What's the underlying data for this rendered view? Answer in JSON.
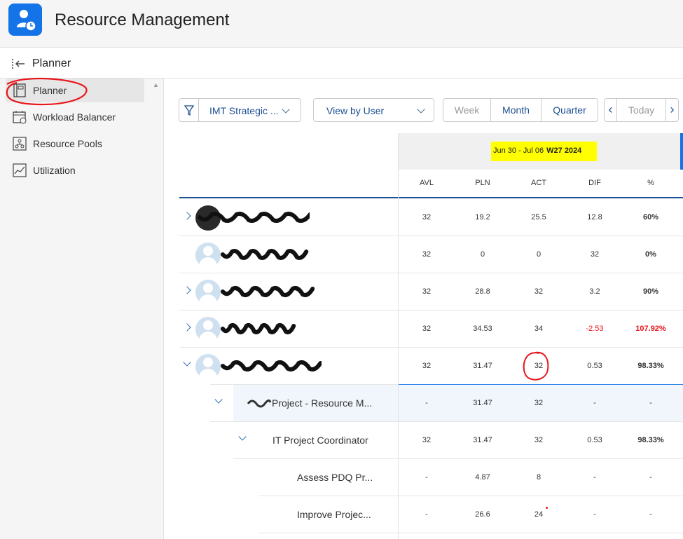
{
  "app": {
    "title": "Resource Management",
    "logo_icon": "user-clock-icon",
    "brand_color": "#1473e6"
  },
  "page": {
    "title": "Planner",
    "collapse_icon": "collapse-left-icon"
  },
  "sidebar": {
    "items": [
      {
        "label": "Planner",
        "icon": "planner-icon",
        "active": true
      },
      {
        "label": "Workload Balancer",
        "icon": "calendar-check-icon",
        "active": false
      },
      {
        "label": "Resource Pools",
        "icon": "org-chart-icon",
        "active": false
      },
      {
        "label": "Utilization",
        "icon": "line-chart-icon",
        "active": false
      }
    ]
  },
  "toolbar": {
    "filter_icon": "filter-icon",
    "project_filter": "IMT Strategic ...",
    "view_select": "View by User",
    "period_tabs": [
      {
        "label": "Week",
        "state": "disabled"
      },
      {
        "label": "Month",
        "state": "enabled"
      },
      {
        "label": "Quarter",
        "state": "enabled"
      }
    ],
    "prev_label": "‹",
    "today_label": "Today",
    "next_label": "›"
  },
  "grid": {
    "week_range": "Jun 30 - Jul 06",
    "week_code": "W27 2024",
    "columns": [
      "AVL",
      "PLN",
      "ACT",
      "DIF",
      "%"
    ],
    "rows": [
      {
        "label": "",
        "level": 0,
        "expander": "collapsed",
        "avatar": "photo",
        "redacted": true,
        "AVL": "32",
        "PLN": "19.2",
        "ACT": "25.5",
        "DIF": "12.8",
        "PCT": "60%",
        "over": false
      },
      {
        "label": "",
        "level": 0,
        "expander": "none",
        "avatar": "placeholder",
        "redacted": true,
        "AVL": "32",
        "PLN": "0",
        "ACT": "0",
        "DIF": "32",
        "PCT": "0%",
        "over": false
      },
      {
        "label": "",
        "level": 0,
        "expander": "collapsed",
        "avatar": "placeholder",
        "redacted": true,
        "AVL": "32",
        "PLN": "28.8",
        "ACT": "32",
        "DIF": "3.2",
        "PCT": "90%",
        "over": false
      },
      {
        "label": "",
        "level": 0,
        "expander": "collapsed",
        "avatar": "placeholder",
        "redacted": true,
        "AVL": "32",
        "PLN": "34.53",
        "ACT": "34",
        "DIF": "-2.53",
        "PCT": "107.92%",
        "over": true
      },
      {
        "label": "",
        "level": 0,
        "expander": "expanded",
        "avatar": "placeholder",
        "redacted": true,
        "AVL": "32",
        "PLN": "31.47",
        "ACT": "32",
        "DIF": "0.53",
        "PCT": "98.33%",
        "over": false,
        "highlight_act": true
      },
      {
        "label": "Project - Resource M...",
        "level": 1,
        "expander": "expanded",
        "avatar": "none",
        "redacted": true,
        "AVL": "-",
        "PLN": "31.47",
        "ACT": "32",
        "DIF": "-",
        "PCT": "-",
        "over": false,
        "shaded": true
      },
      {
        "label": "IT Project Coordinator",
        "level": 2,
        "expander": "expanded",
        "avatar": "none",
        "redacted": false,
        "AVL": "32",
        "PLN": "31.47",
        "ACT": "32",
        "DIF": "0.53",
        "PCT": "98.33%",
        "over": false
      },
      {
        "label": "Assess PDQ Pr...",
        "level": 3,
        "expander": "none",
        "avatar": "none",
        "redacted": false,
        "AVL": "-",
        "PLN": "4.87",
        "ACT": "8",
        "DIF": "-",
        "PCT": "-",
        "over": false
      },
      {
        "label": "Improve Projec...",
        "level": 3,
        "expander": "none",
        "avatar": "none",
        "redacted": false,
        "AVL": "-",
        "PLN": "26.6",
        "ACT": "24",
        "DIF": "-",
        "PCT": "-",
        "over": false,
        "dot": true
      }
    ]
  },
  "colors": {
    "annotation": "#e8161b",
    "highlight": "#ffff00",
    "link": "#1d4f91",
    "negative": "#e8161b"
  }
}
